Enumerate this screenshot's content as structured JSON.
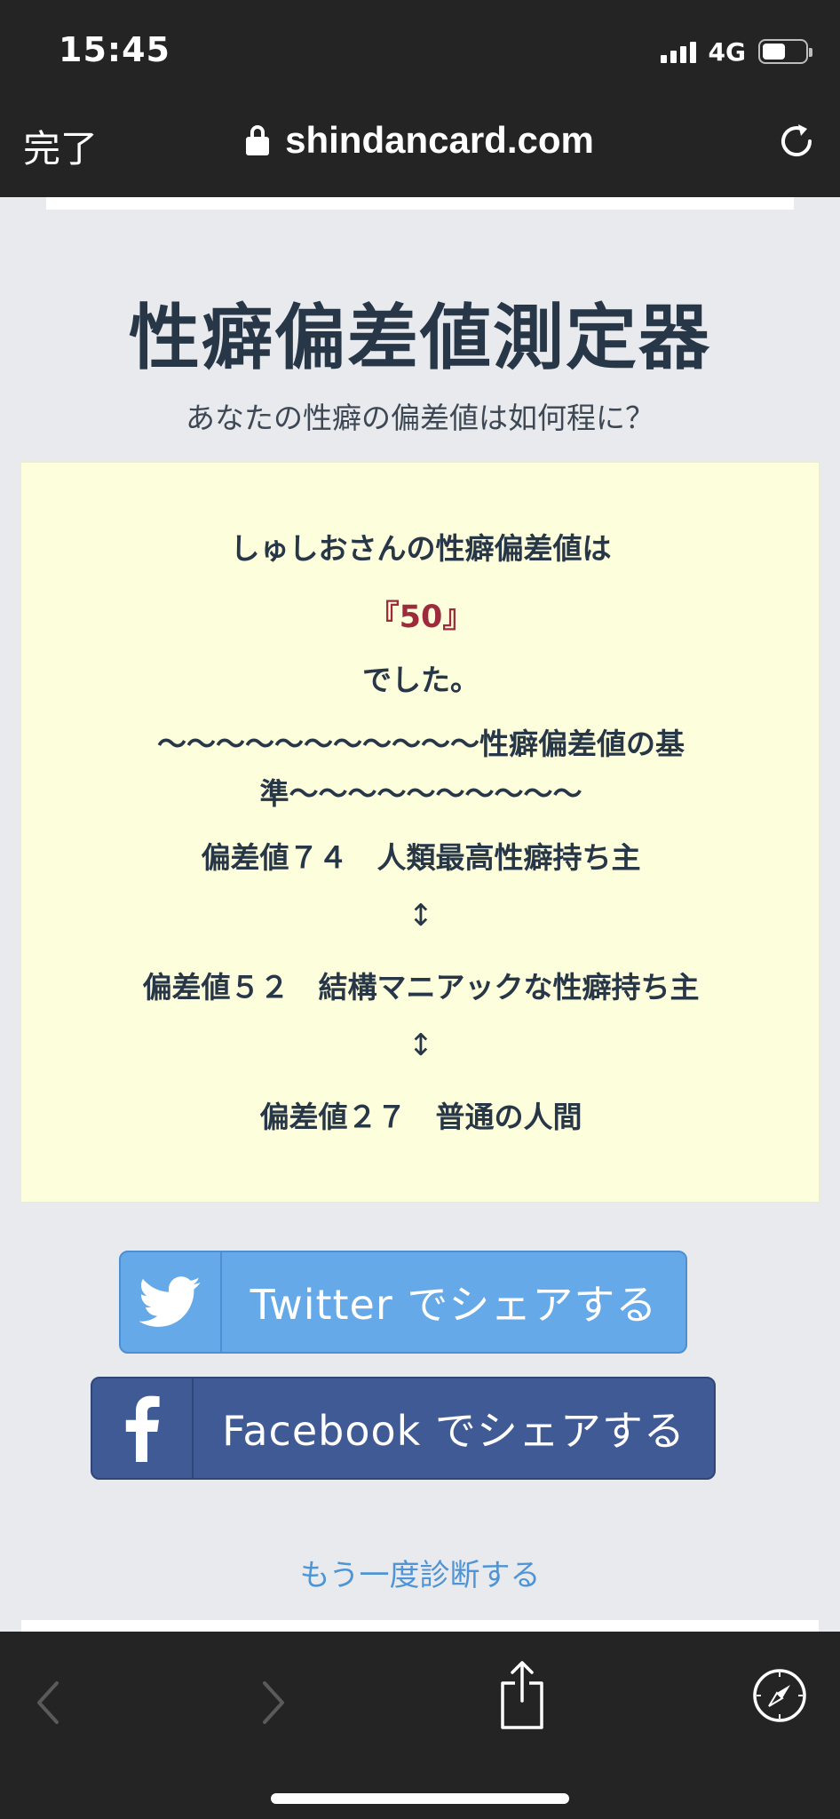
{
  "status": {
    "time": "15:45",
    "network": "4G",
    "battery_level": 0.55
  },
  "browser": {
    "done_label": "完了",
    "url": "shindancard.com"
  },
  "page": {
    "title": "性癖偏差値測定器",
    "subtitle": "あなたの性癖の偏差値は如何程に？",
    "result": {
      "line1": "しゅしおさんの性癖偏差値は",
      "score": "『50』",
      "line3": "でした。",
      "criteria_line1": "〜〜〜〜〜〜〜〜〜〜〜性癖偏差値の基",
      "criteria_line2": "準〜〜〜〜〜〜〜〜〜〜",
      "level_74": "偏差値７４　人類最高性癖持ち主",
      "arrow1": "↕",
      "level_52": "偏差値５２　結構マニアックな性癖持ち主",
      "arrow2": "↕",
      "level_27": "偏差値２７　普通の人間"
    },
    "twitter_label": "Twitter でシェアする",
    "facebook_label": "Facebook でシェアする",
    "retry_label": "もう一度診断する"
  },
  "colors": {
    "twitter": "#65a9e8",
    "facebook": "#3f5a94",
    "result_bg": "#fdfedb",
    "score": "#9c2c3b",
    "link": "#4f95d6"
  },
  "icons": [
    "lock-icon",
    "reload-icon",
    "twitter-bird-icon",
    "facebook-f-icon",
    "back-arrow-icon",
    "forward-arrow-icon",
    "share-icon",
    "safari-compass-icon"
  ]
}
